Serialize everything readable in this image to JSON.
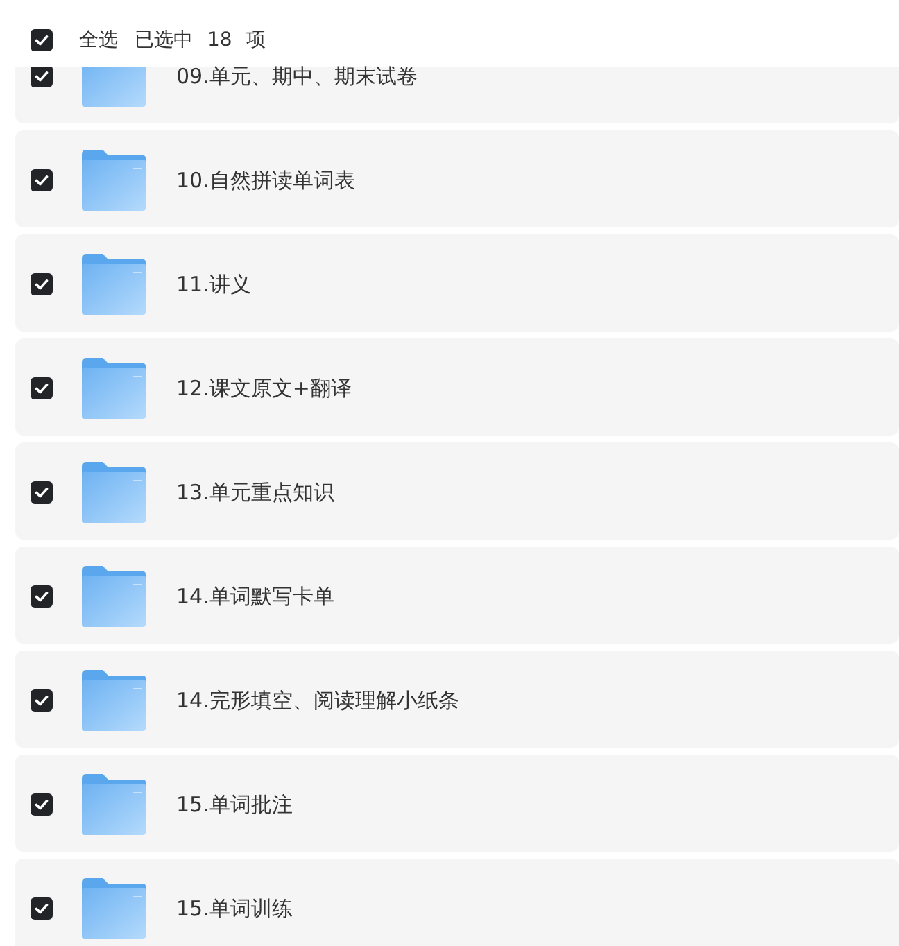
{
  "header": {
    "select_all": {
      "label": "全选",
      "checked": true
    },
    "summary": "已选中 18 项"
  },
  "folders": [
    {
      "name": "09.单元、期中、期末试卷",
      "checked": true
    },
    {
      "name": "10.自然拼读单词表",
      "checked": true
    },
    {
      "name": "11.讲义",
      "checked": true
    },
    {
      "name": "12.课文原文+翻译",
      "checked": true
    },
    {
      "name": "13.单元重点知识",
      "checked": true
    },
    {
      "name": "14.单词默写卡单",
      "checked": true
    },
    {
      "name": "14.完形填空、阅读理解小纸条",
      "checked": true
    },
    {
      "name": "15.单词批注",
      "checked": true
    },
    {
      "name": "15.单词训练",
      "checked": true
    }
  ]
}
